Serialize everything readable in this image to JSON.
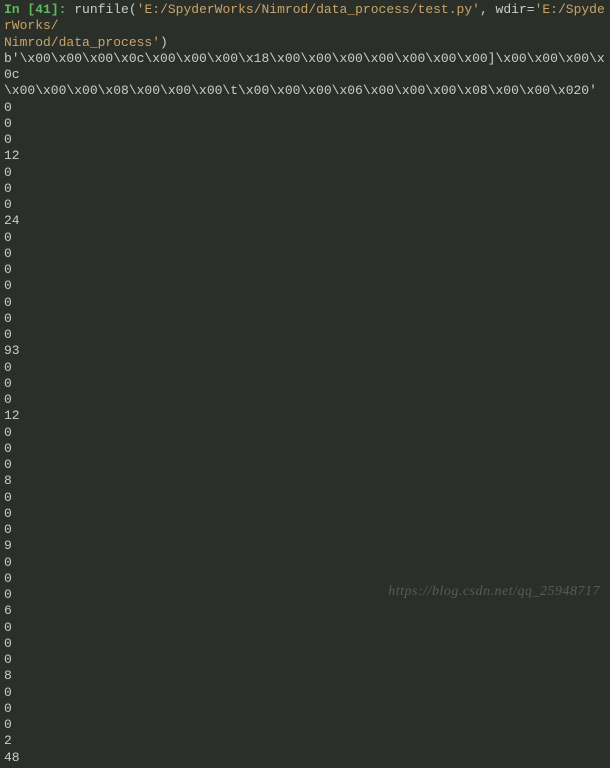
{
  "prompt": {
    "in_label": "In ",
    "open_br": "[",
    "number": "41",
    "close_br": "]:",
    "space": " "
  },
  "code": {
    "func": "runfile",
    "open_p": "(",
    "arg1": "'E:/SpyderWorks/Nimrod/data_process/test.py'",
    "comma": ", ",
    "kwarg": "wdir=",
    "arg2_line1": "'E:/SpyderWorks/",
    "arg2_line2": "Nimrod/data_process'",
    "close_p": ")"
  },
  "bytes_output": {
    "line1": "b'\\x00\\x00\\x00\\x0c\\x00\\x00\\x00\\x18\\x00\\x00\\x00\\x00\\x00\\x00\\x00]\\x00\\x00\\x00\\x0c",
    "line2": "\\x00\\x00\\x00\\x08\\x00\\x00\\x00\\t\\x00\\x00\\x00\\x06\\x00\\x00\\x00\\x08\\x00\\x00\\x020'"
  },
  "numbers": [
    "0",
    "0",
    "0",
    "12",
    "0",
    "0",
    "0",
    "24",
    "0",
    "0",
    "0",
    "0",
    "0",
    "0",
    "0",
    "93",
    "0",
    "0",
    "0",
    "12",
    "0",
    "0",
    "0",
    "8",
    "0",
    "0",
    "0",
    "9",
    "0",
    "0",
    "0",
    "6",
    "0",
    "0",
    "0",
    "8",
    "0",
    "0",
    "0",
    "2",
    "48"
  ],
  "watermark": "https://blog.csdn.net/qq_25948717"
}
